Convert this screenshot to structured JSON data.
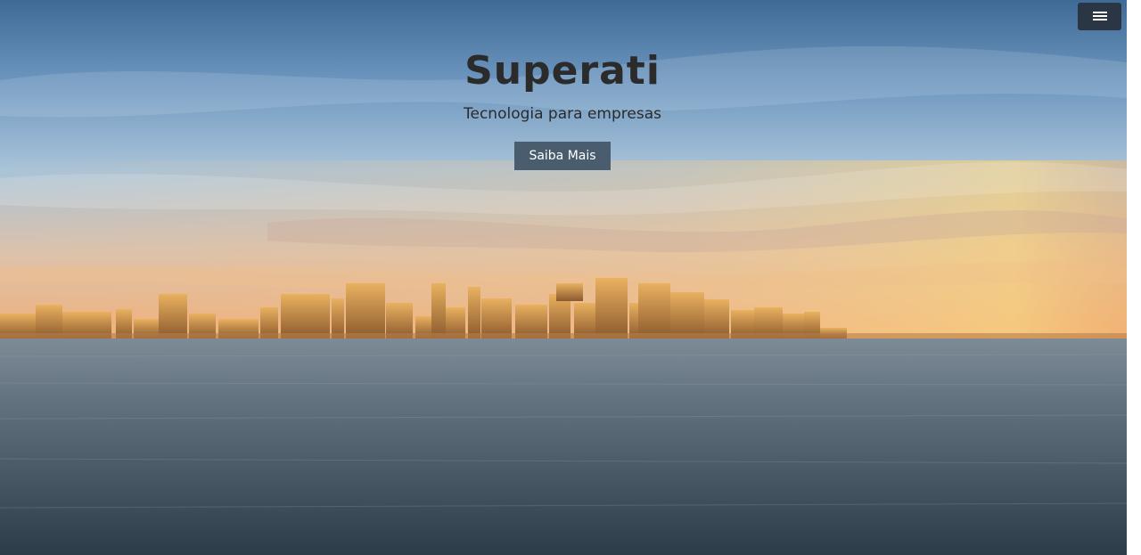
{
  "hero": {
    "title": "Superati",
    "subtitle": "Tecnologia para empresas",
    "cta_label": "Saiba Mais"
  },
  "menu": {
    "icon": "hamburger-menu-icon"
  },
  "colors": {
    "button_bg": "#4a5d6f",
    "menu_bg": "#2b3644",
    "title_text": "#2b2b2b"
  }
}
